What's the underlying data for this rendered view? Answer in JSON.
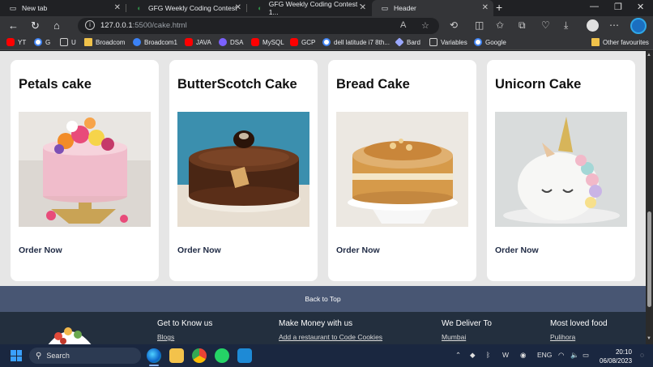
{
  "browser": {
    "tabs": [
      {
        "title": "New tab",
        "active": false
      },
      {
        "title": "GFG Weekly Coding Contest",
        "active": false
      },
      {
        "title": "GFG Weekly Coding Contest - 1...",
        "active": false
      },
      {
        "title": "Header",
        "active": true
      }
    ],
    "url_host": "127.0.0.1",
    "url_path": ":5500/cake.html",
    "bookmarks": [
      {
        "label": "YT",
        "icon": "youtube-icon"
      },
      {
        "label": "G",
        "icon": "google-icon"
      },
      {
        "label": "U",
        "icon": "udemy-icon"
      },
      {
        "label": "Broadcom",
        "icon": "folder-icon"
      },
      {
        "label": "Broadcom1",
        "icon": "broadcom-icon"
      },
      {
        "label": "JAVA",
        "icon": "youtube-icon"
      },
      {
        "label": "DSA",
        "icon": "dsa-icon"
      },
      {
        "label": "MySQL",
        "icon": "youtube-icon"
      },
      {
        "label": "GCP",
        "icon": "youtube-icon"
      },
      {
        "label": "dell latitude i7 8th...",
        "icon": "google-icon"
      },
      {
        "label": "Bard",
        "icon": "bard-icon"
      },
      {
        "label": "Variables",
        "icon": "document-icon"
      },
      {
        "label": "Google",
        "icon": "google-icon"
      }
    ],
    "other_favourites": "Other favourites"
  },
  "page": {
    "cards": [
      {
        "title": "Petals cake",
        "action": "Order Now"
      },
      {
        "title": "ButterScotch Cake",
        "action": "Order Now"
      },
      {
        "title": "Bread Cake",
        "action": "Order Now"
      },
      {
        "title": "Unicorn Cake",
        "action": "Order Now"
      }
    ],
    "back_to_top": "Back to Top",
    "footer": [
      {
        "heading": "Get to Know us",
        "link": "Blogs"
      },
      {
        "heading": "Make Money with us",
        "link": "Add a restaurant to Code Cookies"
      },
      {
        "heading": "We Deliver To",
        "link": "Mumbai"
      },
      {
        "heading": "Most loved food",
        "link": "Pulihora"
      }
    ]
  },
  "taskbar": {
    "search_label": "Search",
    "language": "ENG",
    "time": "20:10",
    "date": "06/08/2023"
  },
  "colors": {
    "page_bg": "#e6e6e6",
    "back_to_top_bg": "#485673",
    "footer_bg": "#232f3e",
    "chrome_bg": "#202124"
  }
}
